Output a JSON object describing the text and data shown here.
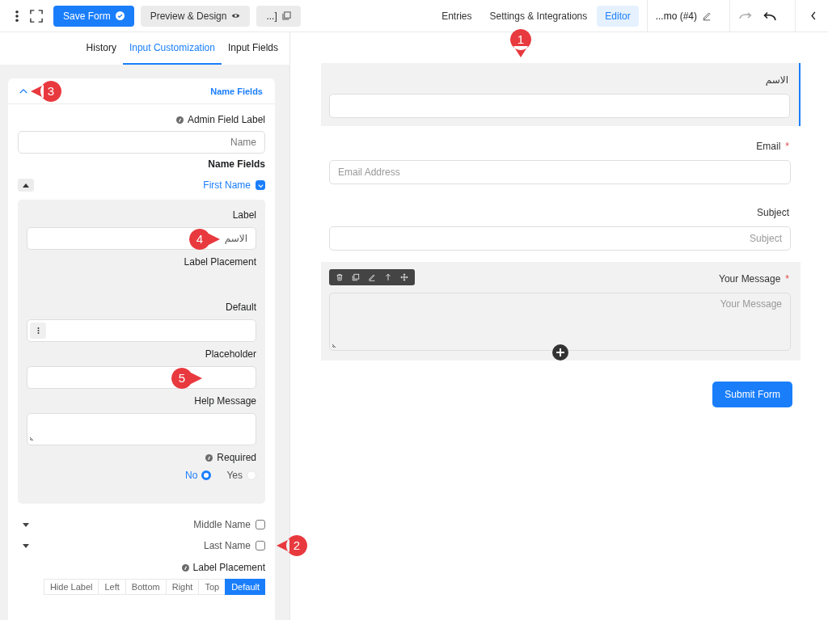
{
  "toolbar": {
    "save_button": "Save Form",
    "preview_button": "Preview & Design",
    "shortcode_button": "...]"
  },
  "nav": [
    {
      "label": "Entries",
      "selected": false
    },
    {
      "label": "Settings & Integrations",
      "selected": false
    },
    {
      "label": "Editor",
      "selected": true
    }
  ],
  "form_title": "...mo (#4)",
  "panel_tabs": [
    {
      "label": "History",
      "selected": false
    },
    {
      "label": "Input Customization",
      "selected": true
    },
    {
      "label": "Input Fields",
      "selected": false
    }
  ],
  "section": {
    "title": "Name Fields",
    "expanded": true,
    "admin_label": "Admin Field Label",
    "admin_value": "Name",
    "subheading": "Name Fields",
    "subfields": [
      {
        "label": "First Name",
        "enabled": true,
        "expanded": true
      },
      {
        "label": "Middle Name",
        "enabled": false,
        "expanded": false
      },
      {
        "label": "Last Name",
        "enabled": false,
        "expanded": false
      }
    ],
    "detail": {
      "label_title": "Label",
      "label_value": "الاسم",
      "placement_title": "Label Placement",
      "default_title": "Default",
      "placeholder_title": "Placeholder",
      "help_title": "Help Message",
      "required_title": "Required",
      "required_options": [
        {
          "label": "No",
          "selected": true
        },
        {
          "label": "Yes",
          "selected": false
        }
      ]
    },
    "label_placement": {
      "title": "Label Placement",
      "options": [
        {
          "label": "Hide Label",
          "selected": false
        },
        {
          "label": "Left",
          "selected": false
        },
        {
          "label": "Bottom",
          "selected": false
        },
        {
          "label": "Right",
          "selected": false
        },
        {
          "label": "Top",
          "selected": false
        },
        {
          "label": "Default",
          "selected": true
        }
      ]
    }
  },
  "form": {
    "fields": [
      {
        "kind": "text",
        "label": "الاسم",
        "required": false,
        "selected": true,
        "hovered": false
      },
      {
        "kind": "email",
        "label": "Email",
        "placeholder": "Email Address",
        "required": true,
        "selected": false,
        "hovered": false
      },
      {
        "kind": "text",
        "label": "Subject",
        "placeholder": "Subject",
        "required": false,
        "selected": false,
        "hovered": false
      },
      {
        "kind": "textarea",
        "label": "Your Message",
        "placeholder": "Your Message",
        "required": true,
        "selected": false,
        "hovered": true
      }
    ],
    "required_mark": "*",
    "submit": "Submit Form"
  },
  "callouts": [
    "1",
    "2",
    "3",
    "4",
    "5"
  ]
}
